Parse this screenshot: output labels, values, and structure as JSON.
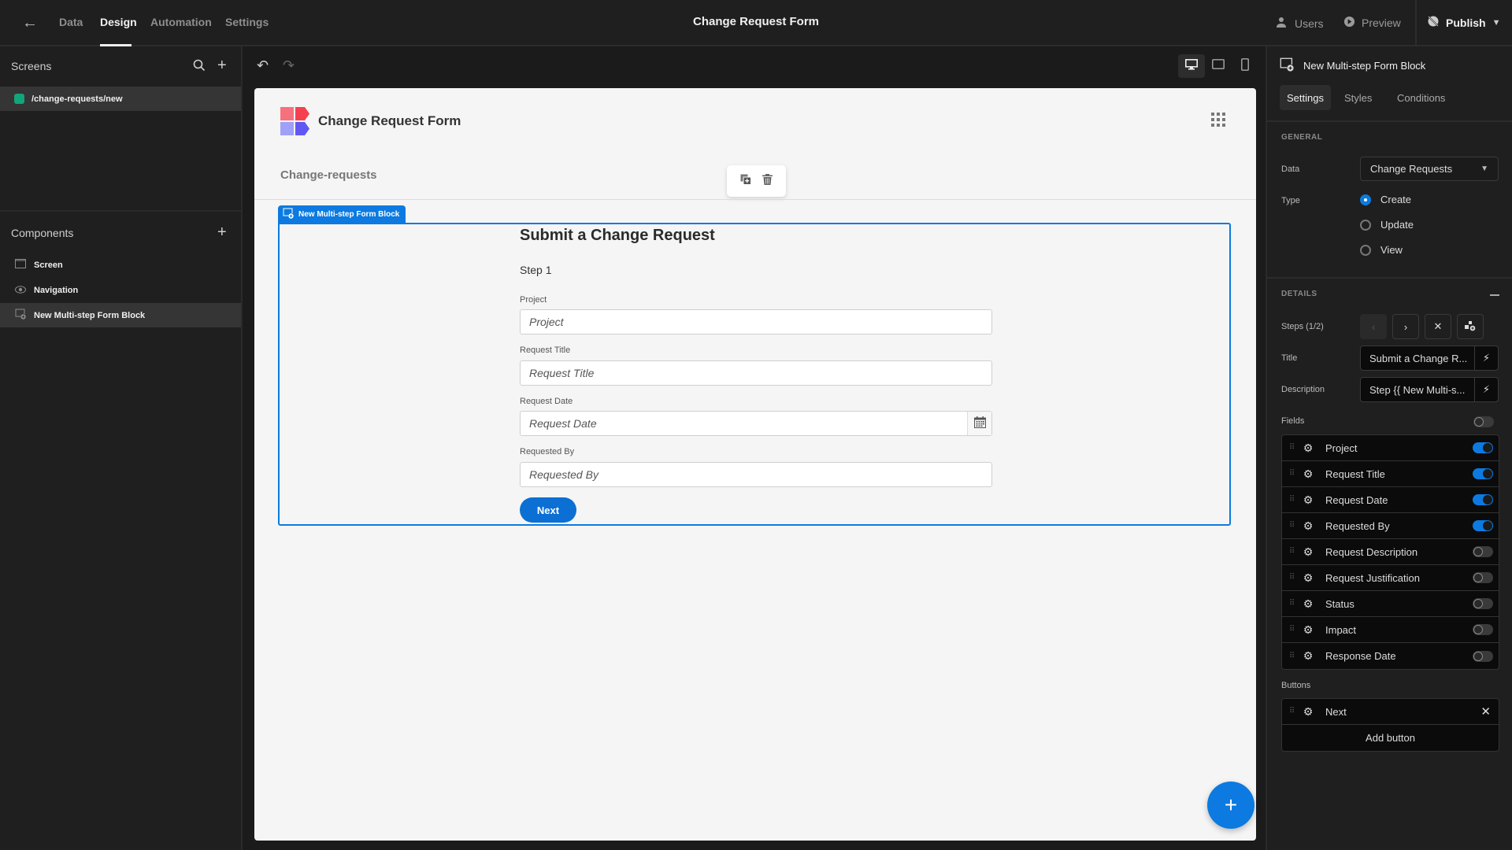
{
  "topbar": {
    "back_icon": "arrow-left-icon",
    "tabs": [
      {
        "label": "Data",
        "active": false
      },
      {
        "label": "Design",
        "active": true
      },
      {
        "label": "Automation",
        "active": false
      },
      {
        "label": "Settings",
        "active": false
      }
    ],
    "title": "Change Request Form",
    "users_label": "Users",
    "preview_label": "Preview",
    "publish_label": "Publish"
  },
  "left": {
    "screens_title": "Screens",
    "screens": [
      {
        "route": "/change-requests/new",
        "color": "#12a47b"
      }
    ],
    "components_title": "Components",
    "components": [
      {
        "label": "Screen",
        "icon": "screen-icon",
        "selected": false
      },
      {
        "label": "Navigation",
        "icon": "eye-icon",
        "selected": false
      },
      {
        "label": "New Multi-step Form Block",
        "icon": "form-block-icon",
        "selected": true
      }
    ]
  },
  "canvas": {
    "app_title": "Change Request Form",
    "breadcrumb": "Change-requests",
    "block_tag": "New Multi-step Form Block",
    "form": {
      "title": "Submit a Change Request",
      "step": "Step 1",
      "fields": [
        {
          "label": "Project",
          "placeholder": "Project",
          "type": "text"
        },
        {
          "label": "Request Title",
          "placeholder": "Request Title",
          "type": "text"
        },
        {
          "label": "Request Date",
          "placeholder": "Request Date",
          "type": "date"
        },
        {
          "label": "Requested By",
          "placeholder": "Requested By",
          "type": "text"
        }
      ],
      "next_label": "Next"
    },
    "fab_label": "+"
  },
  "right": {
    "component_name": "New Multi-step Form Block",
    "tabs": [
      {
        "label": "Settings",
        "active": true
      },
      {
        "label": "Styles",
        "active": false
      },
      {
        "label": "Conditions",
        "active": false
      }
    ],
    "general": {
      "title": "GENERAL",
      "data_label": "Data",
      "data_value": "Change Requests",
      "type_label": "Type",
      "type_options": [
        {
          "label": "Create",
          "selected": true
        },
        {
          "label": "Update",
          "selected": false
        },
        {
          "label": "View",
          "selected": false
        }
      ]
    },
    "details": {
      "title": "DETAILS",
      "steps_label": "Steps (1/2)",
      "title_label": "Title",
      "title_value": "Submit a Change R...",
      "description_label": "Description",
      "description_value": "Step {{ New Multi-s...",
      "fields_label": "Fields",
      "fields_all_on": false,
      "fields": [
        {
          "name": "Project",
          "on": true
        },
        {
          "name": "Request Title",
          "on": true
        },
        {
          "name": "Request Date",
          "on": true
        },
        {
          "name": "Requested By",
          "on": true
        },
        {
          "name": "Request Description",
          "on": false
        },
        {
          "name": "Request Justification",
          "on": false
        },
        {
          "name": "Status",
          "on": false
        },
        {
          "name": "Impact",
          "on": false
        },
        {
          "name": "Response Date",
          "on": false
        }
      ],
      "buttons_label": "Buttons",
      "buttons": [
        {
          "name": "Next"
        }
      ],
      "add_button_label": "Add button"
    }
  },
  "colors": {
    "accent": "#0c7ae0",
    "screen_dot": "#12a47b",
    "panel_bg": "#1f1f1f",
    "canvas_bg": "#f5f5f5"
  }
}
